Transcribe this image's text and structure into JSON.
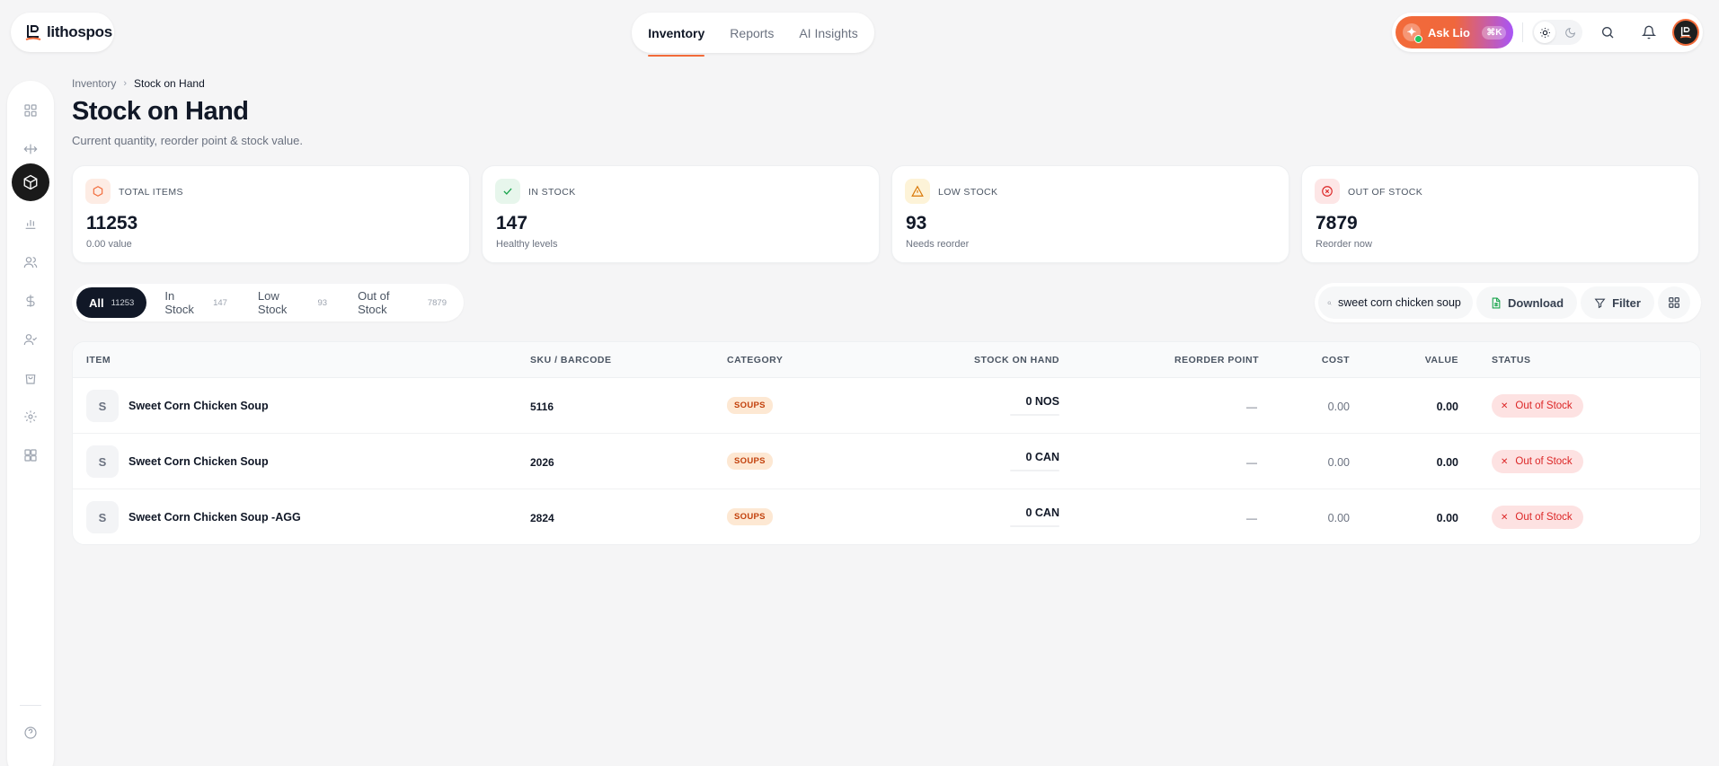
{
  "app": {
    "name": "lithospos"
  },
  "topnav": {
    "items": [
      "Inventory",
      "Reports",
      "AI Insights"
    ],
    "active": 0
  },
  "header": {
    "ask_label": "Ask Lio",
    "ask_badge": "⌘K"
  },
  "breadcrumb": {
    "parent": "Inventory",
    "current": "Stock on Hand"
  },
  "page": {
    "title": "Stock on Hand",
    "subtitle": "Current quantity, reorder point & stock value."
  },
  "stats": [
    {
      "label": "TOTAL ITEMS",
      "value": "11253",
      "hint": "0.00 value",
      "color": "#f26b3a",
      "bg": "#fdece4",
      "icon": "box-icon"
    },
    {
      "label": "IN STOCK",
      "value": "147",
      "hint": "Healthy levels",
      "color": "#16a34a",
      "bg": "#e7f6ec",
      "icon": "check-icon"
    },
    {
      "label": "LOW STOCK",
      "value": "93",
      "hint": "Needs reorder",
      "color": "#d97706",
      "bg": "#fdf3d8",
      "icon": "warning-icon"
    },
    {
      "label": "OUT OF STOCK",
      "value": "7879",
      "hint": "Reorder now",
      "color": "#dc2626",
      "bg": "#fde6e6",
      "icon": "x-circle-icon"
    }
  ],
  "tabs": [
    {
      "label": "All",
      "count": "11253"
    },
    {
      "label": "In Stock",
      "count": "147"
    },
    {
      "label": "Low Stock",
      "count": "93"
    },
    {
      "label": "Out of Stock",
      "count": "7879"
    }
  ],
  "toolbar": {
    "search_value": "sweet corn chicken soup",
    "download_label": "Download",
    "filter_label": "Filter"
  },
  "table": {
    "columns": [
      "ITEM",
      "SKU / BARCODE",
      "CATEGORY",
      "STOCK ON HAND",
      "REORDER POINT",
      "COST",
      "VALUE",
      "STATUS"
    ],
    "rows": [
      {
        "initial": "S",
        "name": "Sweet Corn Chicken Soup",
        "sku": "5116",
        "category": "SOUPS",
        "stock": "0 NOS",
        "reorder": "—",
        "cost": "0.00",
        "value": "0.00",
        "status": "Out of Stock"
      },
      {
        "initial": "S",
        "name": "Sweet Corn Chicken Soup",
        "sku": "2026",
        "category": "SOUPS",
        "stock": "0 CAN",
        "reorder": "—",
        "cost": "0.00",
        "value": "0.00",
        "status": "Out of Stock"
      },
      {
        "initial": "S",
        "name": "Sweet Corn Chicken Soup -AGG",
        "sku": "2824",
        "category": "SOUPS",
        "stock": "0 CAN",
        "reorder": "—",
        "cost": "0.00",
        "value": "0.00",
        "status": "Out of Stock"
      }
    ]
  },
  "colors": {
    "accent": "#f26b3a",
    "dark": "#111827",
    "danger": "#dc2626"
  }
}
